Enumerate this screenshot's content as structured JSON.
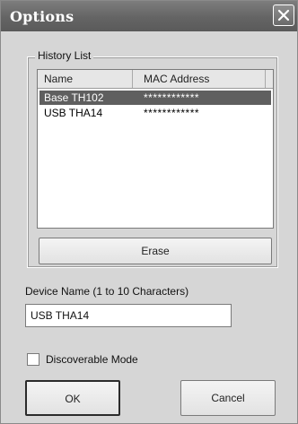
{
  "window": {
    "title": "Options"
  },
  "history": {
    "group_label": "History List",
    "columns": [
      "Name",
      "MAC Address"
    ],
    "rows": [
      {
        "name": "Base TH102",
        "mac": "************",
        "selected": true
      },
      {
        "name": "USB THA14",
        "mac": "************",
        "selected": false
      }
    ],
    "erase_label": "Erase"
  },
  "device": {
    "label": "Device Name (1 to 10 Characters)",
    "value": "USB THA14"
  },
  "discoverable": {
    "label": "Discoverable Mode",
    "checked": false
  },
  "buttons": {
    "ok": "OK",
    "cancel": "Cancel"
  }
}
